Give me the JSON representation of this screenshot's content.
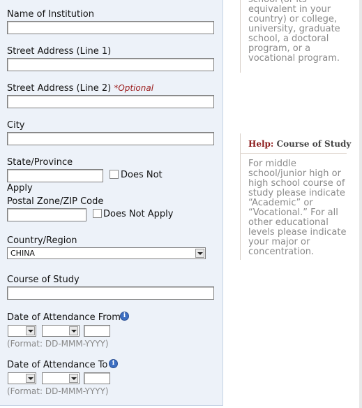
{
  "form": {
    "name_of_institution": {
      "label": "Name of Institution",
      "value": ""
    },
    "street1": {
      "label": "Street Address (Line 1)",
      "value": ""
    },
    "street2": {
      "label": "Street Address (Line 2)",
      "optional": "*Optional",
      "value": ""
    },
    "city": {
      "label": "City",
      "value": ""
    },
    "state": {
      "label": "State/Province",
      "value": "",
      "dna_label": "Does Not",
      "dna_label_wrap": "Apply"
    },
    "postal": {
      "label": "Postal Zone/ZIP Code",
      "value": "",
      "dna_label": "Does Not Apply"
    },
    "country": {
      "label": "Country/Region",
      "selected": "CHINA"
    },
    "course": {
      "label": "Course of Study",
      "value": ""
    },
    "date_from": {
      "label": "Date of Attendance From",
      "format": "(Format: DD-MMM-YYYY)"
    },
    "date_to": {
      "label": "Date of Attendance To",
      "format": "(Format: DD-MMM-YYYY)"
    }
  },
  "help_top": {
    "text": "school (or its equivalent in your country) or college, university, graduate school, a doctoral program, or a vocational program."
  },
  "help_course": {
    "title_prefix": "Help:",
    "title": "Course of Study",
    "text": "For middle school/junior high or high school course of study please indicate “Academic” or “Vocational.” For all other educational levels please indicate your major or concentration."
  },
  "colors": {
    "panel": "#edf2f9",
    "help_title": "#8b1a1a",
    "optional": "#9b1c1c"
  },
  "icons": {
    "info": "info-icon"
  }
}
